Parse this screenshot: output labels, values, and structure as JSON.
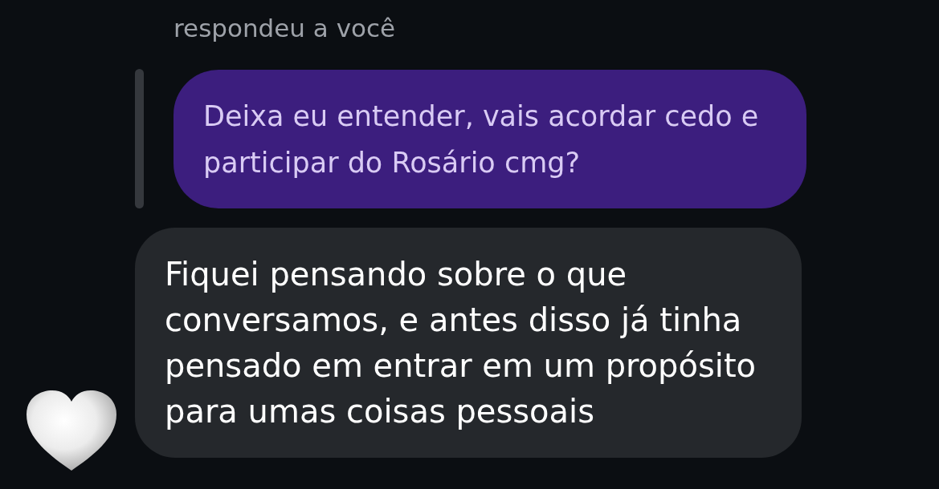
{
  "reply_label": "respondeu a você",
  "messages": [
    {
      "kind": "quoted",
      "text": "Deixa eu entender, vais acordar cedo e participar do Rosário cmg?"
    },
    {
      "kind": "received",
      "text": "Fiquei pensando sobre o que conversamos, e antes disso já tinha pensado em entrar em um propósito para umas coisas pessoais"
    }
  ]
}
